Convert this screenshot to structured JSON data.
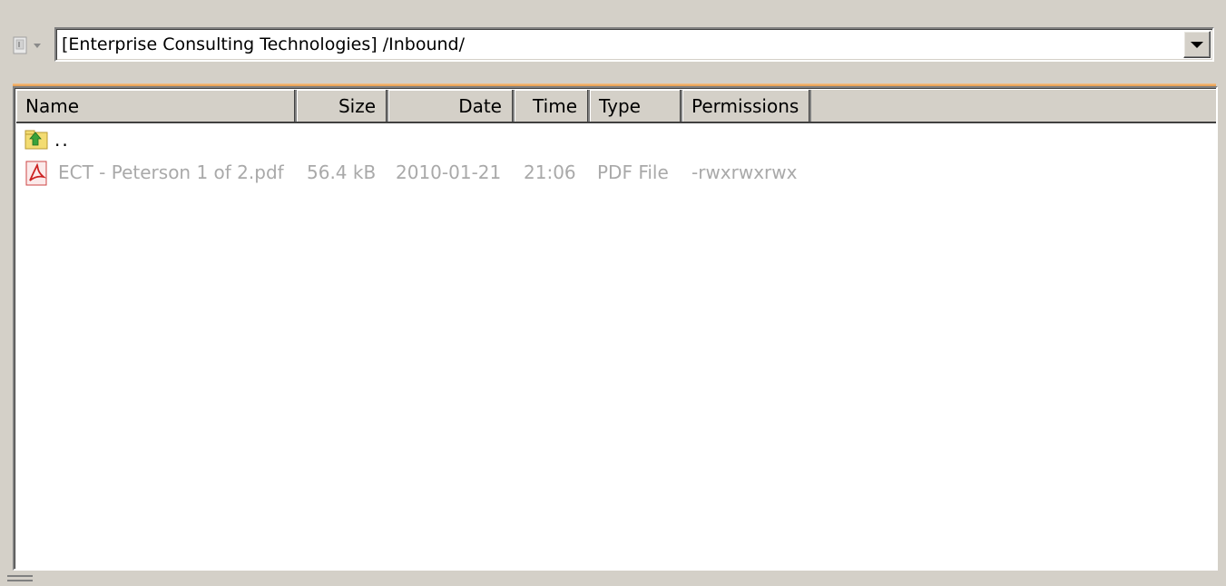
{
  "path_bar": {
    "drive_icon": "drive-icon",
    "path_value": "[Enterprise Consulting Technologies] /Inbound/"
  },
  "columns": [
    {
      "label": "Name"
    },
    {
      "label": "Size"
    },
    {
      "label": "Date"
    },
    {
      "label": "Time"
    },
    {
      "label": "Type"
    },
    {
      "label": "Permissions"
    }
  ],
  "rows": [
    {
      "icon": "parent-folder-icon",
      "name": ".."
    },
    {
      "icon": "pdf-file-icon",
      "name": "ECT - Peterson 1 of 2.pdf",
      "size": "56.4 kB",
      "date": "2010-01-21",
      "time": "21:06",
      "type": "PDF File",
      "permissions": "-rwxrwxrwx"
    }
  ],
  "colors": {
    "accent": "#e69a47",
    "pdf_icon": "#cc2222",
    "folder_icon": "#f0d060",
    "faded_text": "#a9a9a9"
  }
}
